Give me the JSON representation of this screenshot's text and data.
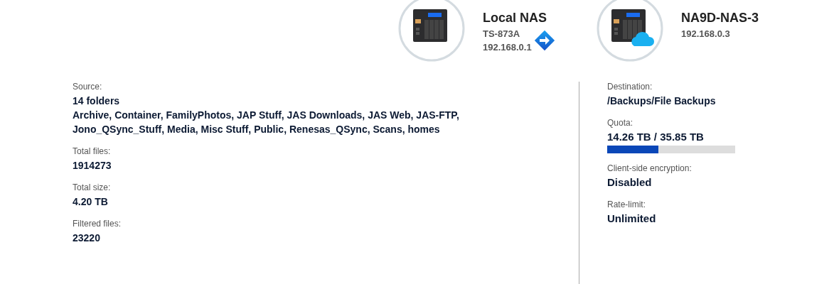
{
  "devices": [
    {
      "kind": "local",
      "name": "Local NAS",
      "model": "TS-873A",
      "ip": "192.168.0.1"
    },
    {
      "kind": "cloud",
      "name": "NA9D-NAS-3",
      "ip": "192.168.0.3"
    }
  ],
  "source": [
    {
      "label": "Source:",
      "value": "14 folders",
      "detail": "Archive, Container, FamilyPhotos, JAP Stuff, JAS Downloads, JAS Web, JAS-FTP, Jono_QSync_Stuff, Media, Misc Stuff, Public, Renesas_QSync, Scans, homes"
    },
    {
      "label": "Total files:",
      "value": "1914273"
    },
    {
      "label": "Total size:",
      "value": "4.20 TB"
    },
    {
      "label": "Filtered files:",
      "value": "23220"
    }
  ],
  "destination": [
    {
      "kind": "text",
      "label": "Destination:",
      "value": "/Backups/File Backups"
    },
    {
      "kind": "quota",
      "label": "Quota:",
      "value": "14.26 TB / 35.85 TB",
      "level": 0.4
    },
    {
      "kind": "large",
      "label": "Client-side encryption:",
      "value": "Disabled"
    },
    {
      "kind": "large",
      "label": "Rate-limit:",
      "value": "Unlimited"
    }
  ]
}
